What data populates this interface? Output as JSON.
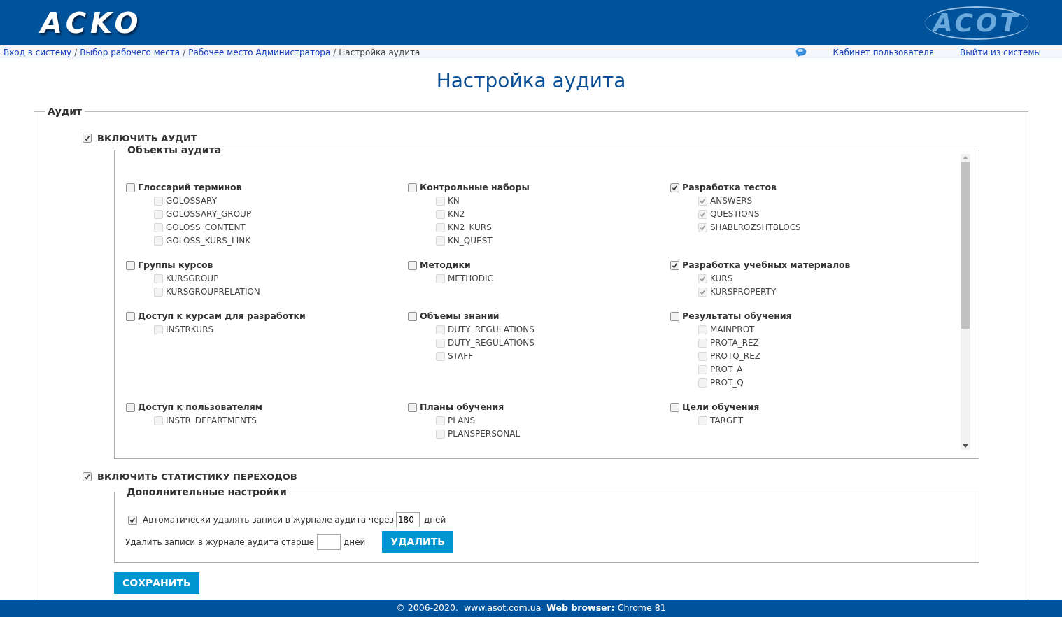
{
  "header": {
    "logo_left": "ACKO",
    "logo_right": "ACOT"
  },
  "breadcrumbs": [
    {
      "label": "Вход в систему",
      "link": true
    },
    {
      "label": "Выбор рабочего места",
      "link": true
    },
    {
      "label": "Рабочее место Администратора",
      "link": true
    },
    {
      "label": "Настройка аудита",
      "link": false
    }
  ],
  "breadcrumb_separator": "/",
  "user_links": [
    "Кабинет пользователя",
    "Выйти из системы"
  ],
  "page_title": "Настройка аудита",
  "audit": {
    "legend": "Аудит",
    "enable_audit": {
      "label": "ВКЛЮЧИТЬ АУДИТ",
      "checked": true
    },
    "objects": {
      "legend": "Объекты аудита",
      "groups": [
        {
          "title": "Глоссарий терминов",
          "checked": false,
          "items": [
            {
              "label": "GOLOSSARY",
              "checked": false
            },
            {
              "label": "GOLOSSARY_GROUP",
              "checked": false
            },
            {
              "label": "GOLOSS_CONTENT",
              "checked": false
            },
            {
              "label": "GOLOSS_KURS_LINK",
              "checked": false
            }
          ]
        },
        {
          "title": "Контрольные наборы",
          "checked": false,
          "items": [
            {
              "label": "KN",
              "checked": false
            },
            {
              "label": "KN2",
              "checked": false
            },
            {
              "label": "KN2_KURS",
              "checked": false
            },
            {
              "label": "KN_QUEST",
              "checked": false
            }
          ]
        },
        {
          "title": "Разработка тестов",
          "checked": true,
          "items": [
            {
              "label": "ANSWERS",
              "checked": true
            },
            {
              "label": "QUESTIONS",
              "checked": true
            },
            {
              "label": "SHABLROZSHTBLOCS",
              "checked": true
            }
          ]
        },
        {
          "title": "Группы курсов",
          "checked": false,
          "items": [
            {
              "label": "KURSGROUP",
              "checked": false
            },
            {
              "label": "KURSGROUPRELATION",
              "checked": false
            }
          ]
        },
        {
          "title": "Методики",
          "checked": false,
          "items": [
            {
              "label": "METHODIC",
              "checked": false
            }
          ]
        },
        {
          "title": "Разработка учебных материалов",
          "checked": true,
          "items": [
            {
              "label": "KURS",
              "checked": true
            },
            {
              "label": "KURSPROPERTY",
              "checked": true
            }
          ]
        },
        {
          "title": "Доступ к курсам для разработки",
          "checked": false,
          "items": [
            {
              "label": "INSTRKURS",
              "checked": false
            }
          ]
        },
        {
          "title": "Объемы знаний",
          "checked": false,
          "items": [
            {
              "label": "DUTY_REGULATIONS",
              "checked": false
            },
            {
              "label": "DUTY_REGULATIONS",
              "checked": false
            },
            {
              "label": "STAFF",
              "checked": false
            }
          ]
        },
        {
          "title": "Результаты обучения",
          "checked": false,
          "items": [
            {
              "label": "MAINPROT",
              "checked": false
            },
            {
              "label": "PROTA_REZ",
              "checked": false
            },
            {
              "label": "PROTQ_REZ",
              "checked": false
            },
            {
              "label": "PROT_A",
              "checked": false
            },
            {
              "label": "PROT_Q",
              "checked": false
            }
          ]
        },
        {
          "title": "Доступ к пользователям",
          "checked": false,
          "items": [
            {
              "label": "INSTR_DEPARTMENTS",
              "checked": false
            }
          ]
        },
        {
          "title": "Планы обучения",
          "checked": false,
          "items": [
            {
              "label": "PLANS",
              "checked": false
            },
            {
              "label": "PLANSPERSONAL",
              "checked": false
            }
          ]
        },
        {
          "title": "Цели обучения",
          "checked": false,
          "items": [
            {
              "label": "TARGET",
              "checked": false
            }
          ]
        }
      ]
    },
    "enable_stats": {
      "label": "ВКЛЮЧИТЬ СТАТИСТИКУ ПЕРЕХОДОВ",
      "checked": true
    },
    "extra": {
      "legend": "Дополнительные настройки",
      "auto_delete": {
        "checked": true,
        "label": "Автоматически удалять записи в журнале аудита через",
        "value": "180",
        "unit": "дней"
      },
      "delete_older": {
        "label": "Удалить записи в журнале аудита старше",
        "unit": "дней",
        "button": "УДАЛИТЬ"
      }
    },
    "save_button": "СОХРАНИТЬ"
  },
  "footer": "© 2006-2020.  www.asot.com.ua  **Web browser:** Chrome 81"
}
